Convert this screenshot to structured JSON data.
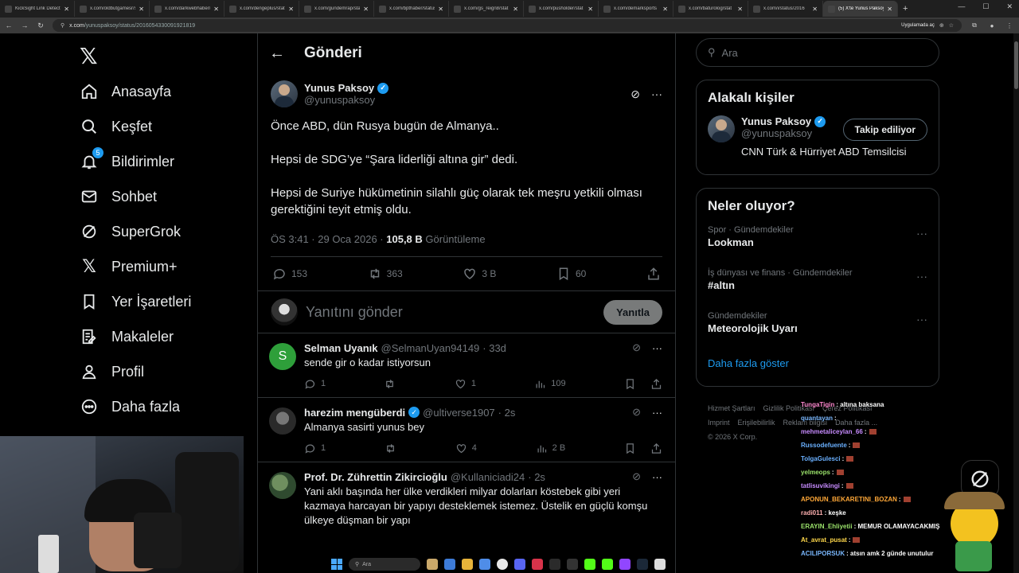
{
  "browser": {
    "tabs": [
      {
        "title": "KickSight Link Detecto"
      },
      {
        "title": "x.com/oldbutgamesr/status"
      },
      {
        "title": "x.com/darkwebhaber/st"
      },
      {
        "title": "x.com/dengeplus/stat"
      },
      {
        "title": "x.com/gundemrap/stat"
      },
      {
        "title": "x.com/bpthaber/status"
      },
      {
        "title": "x.com/gs_reign8/stat"
      },
      {
        "title": "x.com/pusholder/stat"
      },
      {
        "title": "x.com/demarksports"
      },
      {
        "title": "x.com/baturolog/stat"
      },
      {
        "title": "x.com/i/status/2016"
      },
      {
        "title": "(5) X'te Yunus Paksoy"
      }
    ],
    "url_host": "x.com",
    "url_path": "/yunuspaksoy/status/2016054330091921819",
    "open_in_app": "Uygulamada aç"
  },
  "nav": {
    "items": [
      {
        "label": "Anasayfa"
      },
      {
        "label": "Keşfet"
      },
      {
        "label": "Bildirimler",
        "badge": "5"
      },
      {
        "label": "Sohbet"
      },
      {
        "label": "SuperGrok"
      },
      {
        "label": "Premium+"
      },
      {
        "label": "Yer İşaretleri"
      },
      {
        "label": "Makaleler"
      },
      {
        "label": "Profil"
      },
      {
        "label": "Daha fazla"
      }
    ]
  },
  "main": {
    "header_title": "Gönderi",
    "post": {
      "name": "Yunus Paksoy",
      "handle": "@yunuspaksoy",
      "paragraphs": [
        "Önce ABD, dün Rusya bugün de Almanya..",
        "Hepsi de SDG’ye “Şara liderliği altına gir” dedi.",
        "Hepsi de Suriye hükümetinin silahlı güç olarak tek meşru yetkili olması gerektiğini teyit etmiş oldu."
      ],
      "time": "ÖS 3:41 · 29 Oca 2026 · ",
      "views_count": "105,8 B",
      "views_label": " Görüntüleme",
      "replies": "153",
      "reposts": "363",
      "likes": "3 B",
      "bookmarks": "60"
    },
    "reply_box": {
      "placeholder": "Yanıtını gönder",
      "button": "Yanıtla"
    },
    "replies": [
      {
        "name": "Selman Uyanık",
        "handle": "@SelmanUyan94149",
        "time": "· 33d",
        "text": "sende gir o kadar istiyorsun",
        "replies": "1",
        "reposts": "",
        "likes": "1",
        "views": "109",
        "avatar_letter": "S",
        "avatar_color": "#2e9f3a"
      },
      {
        "name": "harezim mengüberdi",
        "handle": "@ultiverse1907",
        "time": "· 2s",
        "text": "Almanya sasirti yunus bey",
        "replies": "1",
        "reposts": "",
        "likes": "4",
        "views": "2 B",
        "avatar_letter": "",
        "avatar_color": "#3b3b3b"
      },
      {
        "name": "Prof. Dr. Zührettin Zikircioğlu",
        "handle": "@Kullaniciadi24",
        "time": "· 2s",
        "text": "Yani aklı başında her ülke verdikleri milyar dolarları köstebek gibi yeri kazmaya harcayan bir yapıyı desteklemek istemez. Üstelik en güçlü komşu ülkeye düşman bir yapı",
        "avatar_letter": "",
        "avatar_color": "#3c5a3c"
      }
    ]
  },
  "right": {
    "search_placeholder": "Ara",
    "related_title": "Alakalı kişiler",
    "person": {
      "name": "Yunus Paksoy",
      "handle": "@yunuspaksoy",
      "follow_label": "Takip ediliyor",
      "bio": "CNN Türk & Hürriyet ABD Temsilcisi"
    },
    "trends_title": "Neler oluyor?",
    "trends": [
      {
        "category": "Spor · Gündemdekiler",
        "topic": "Lookman"
      },
      {
        "category": "İş dünyası ve finans · Gündemdekiler",
        "topic": "#altın"
      },
      {
        "category": "Gündemdekiler",
        "topic": "Meteorolojik Uyarı"
      }
    ],
    "show_more": "Daha fazla göster",
    "footer": {
      "line1": [
        "Hizmet Şartları",
        "Gizlilik Politikası",
        "Çerez Politikası"
      ],
      "line2": [
        "Imprint",
        "Erişilebilirlik",
        "Reklam bilgisi",
        "Daha fazla ..."
      ],
      "copyright": "© 2026 X Corp."
    }
  },
  "chat": [
    {
      "user": "TungaTigin",
      "msg": ": altına baksana",
      "color": "#ff8ad0"
    },
    {
      "user": "quantayan",
      "msg": ":",
      "color": "#7ab8ff"
    },
    {
      "user": "mehmetaliceylan_66",
      "msg": ":",
      "color": "#c78bff"
    },
    {
      "user": "Russodefuente",
      "msg": ":",
      "color": "#6ab0ff"
    },
    {
      "user": "TolgaGulesci",
      "msg": ":",
      "color": "#6ab0ff"
    },
    {
      "user": "yelmeops",
      "msg": ":",
      "color": "#9be36b"
    },
    {
      "user": "tatlisuvikingi",
      "msg": ":",
      "color": "#c78bff"
    },
    {
      "user": "APONUN_BEKARETINI_BOZAN",
      "msg": ":",
      "color": "#ffa838"
    },
    {
      "user": "radi011",
      "msg": ": keşke",
      "color": "#ffb0b0"
    },
    {
      "user": "ERAYIN_Ehliyetii",
      "msg": ": MEMUR OLAMAYACAKMIŞ",
      "color": "#9be36b"
    },
    {
      "user": "At_avrat_pusat",
      "msg": ":",
      "color": "#ffd84a"
    },
    {
      "user": "ACILIPORSUK",
      "msg": ": atsın amk 2 günde unutulur",
      "color": "#7ab8ff"
    }
  ],
  "taskbar": {
    "search": "Ara"
  }
}
